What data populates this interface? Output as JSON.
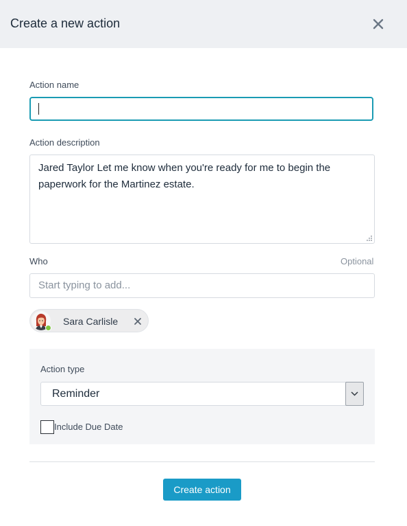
{
  "header": {
    "title": "Create a new action",
    "close_icon": "close-icon"
  },
  "form": {
    "name": {
      "label": "Action name",
      "value": ""
    },
    "description": {
      "label": "Action description",
      "value": "Jared Taylor Let me know when you're ready for me to begin the paperwork for the Martinez estate."
    },
    "who": {
      "label": "Who",
      "optional_label": "Optional",
      "placeholder": "Start typing to add...",
      "selected": [
        {
          "name": "Sara Carlisle",
          "status": "online",
          "status_color": "#7cc441"
        }
      ]
    },
    "action_type": {
      "label": "Action type",
      "selected": "Reminder"
    },
    "due_date": {
      "label": "Include Due Date",
      "checked": false
    }
  },
  "footer": {
    "submit_label": "Create action",
    "accent_color": "#1a9bc7"
  }
}
